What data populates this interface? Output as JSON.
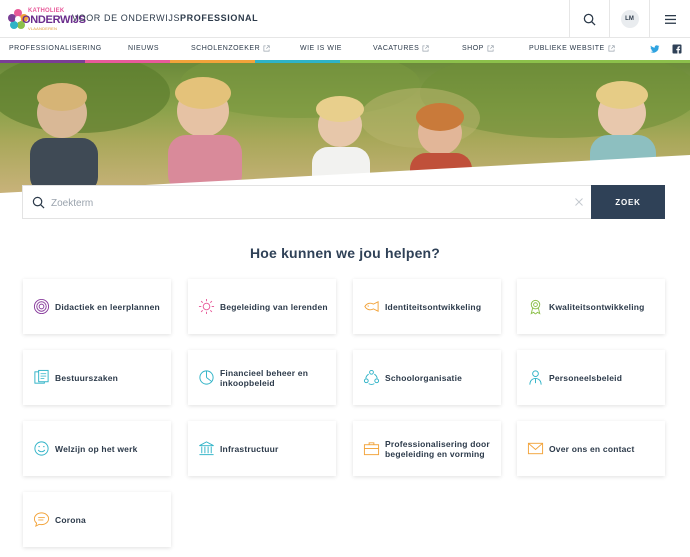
{
  "header": {
    "logo": {
      "top": "KATHOLIEK",
      "main": "ONDERWIJS",
      "sub": "VLAANDEREN"
    },
    "tagline_prefix": "VOOR DE ONDERWIJS",
    "tagline_bold": "PROFESSIONAL",
    "avatar_initials": "LM"
  },
  "nav": {
    "items": [
      {
        "label": "PROFESSIONALISERING",
        "external": false
      },
      {
        "label": "NIEUWS",
        "external": false
      },
      {
        "label": "SCHOLENZOEKER",
        "external": true
      },
      {
        "label": "WIE IS WIE",
        "external": false
      },
      {
        "label": "VACATURES",
        "external": true
      },
      {
        "label": "SHOP",
        "external": true
      },
      {
        "label": "PUBLIEKE WEBSITE",
        "external": true
      }
    ],
    "stripe_colors": [
      "#7a3e96",
      "#e85a9a",
      "#f2a33a",
      "#2fb3c7",
      "#8cc04b"
    ]
  },
  "search": {
    "placeholder": "Zoekterm",
    "button_label": "ZOEK"
  },
  "main": {
    "title": "Hoe kunnen we jou helpen?",
    "cards": [
      {
        "label": "Didactiek en leerplannen",
        "icon": "target-icon",
        "color": "#8a3e9e"
      },
      {
        "label": "Begeleiding van lerenden",
        "icon": "sun-icon",
        "color": "#e85a9a"
      },
      {
        "label": "Identiteitsontwikkeling",
        "icon": "fish-icon",
        "color": "#f2a33a"
      },
      {
        "label": "Kwaliteitsontwikkeling",
        "icon": "award-icon",
        "color": "#8cc04b"
      },
      {
        "label": "Bestuurszaken",
        "icon": "documents-icon",
        "color": "#2fb3c7"
      },
      {
        "label": "Financieel beheer en inkoopbeleid",
        "icon": "pie-chart-icon",
        "color": "#2fb3c7"
      },
      {
        "label": "Schoolorganisatie",
        "icon": "cycle-icon",
        "color": "#2fb3c7"
      },
      {
        "label": "Personeelsbeleid",
        "icon": "person-icon",
        "color": "#2fb3c7"
      },
      {
        "label": "Welzijn op het werk",
        "icon": "smiley-icon",
        "color": "#2fb3c7"
      },
      {
        "label": "Infrastructuur",
        "icon": "building-icon",
        "color": "#2fb3c7"
      },
      {
        "label": "Professionalisering door begeleiding en vorming",
        "icon": "briefcase-icon",
        "color": "#f2a33a"
      },
      {
        "label": "Over ons en contact",
        "icon": "mail-icon",
        "color": "#f2a33a"
      },
      {
        "label": "Corona",
        "icon": "chat-icon",
        "color": "#f2a33a"
      }
    ]
  }
}
